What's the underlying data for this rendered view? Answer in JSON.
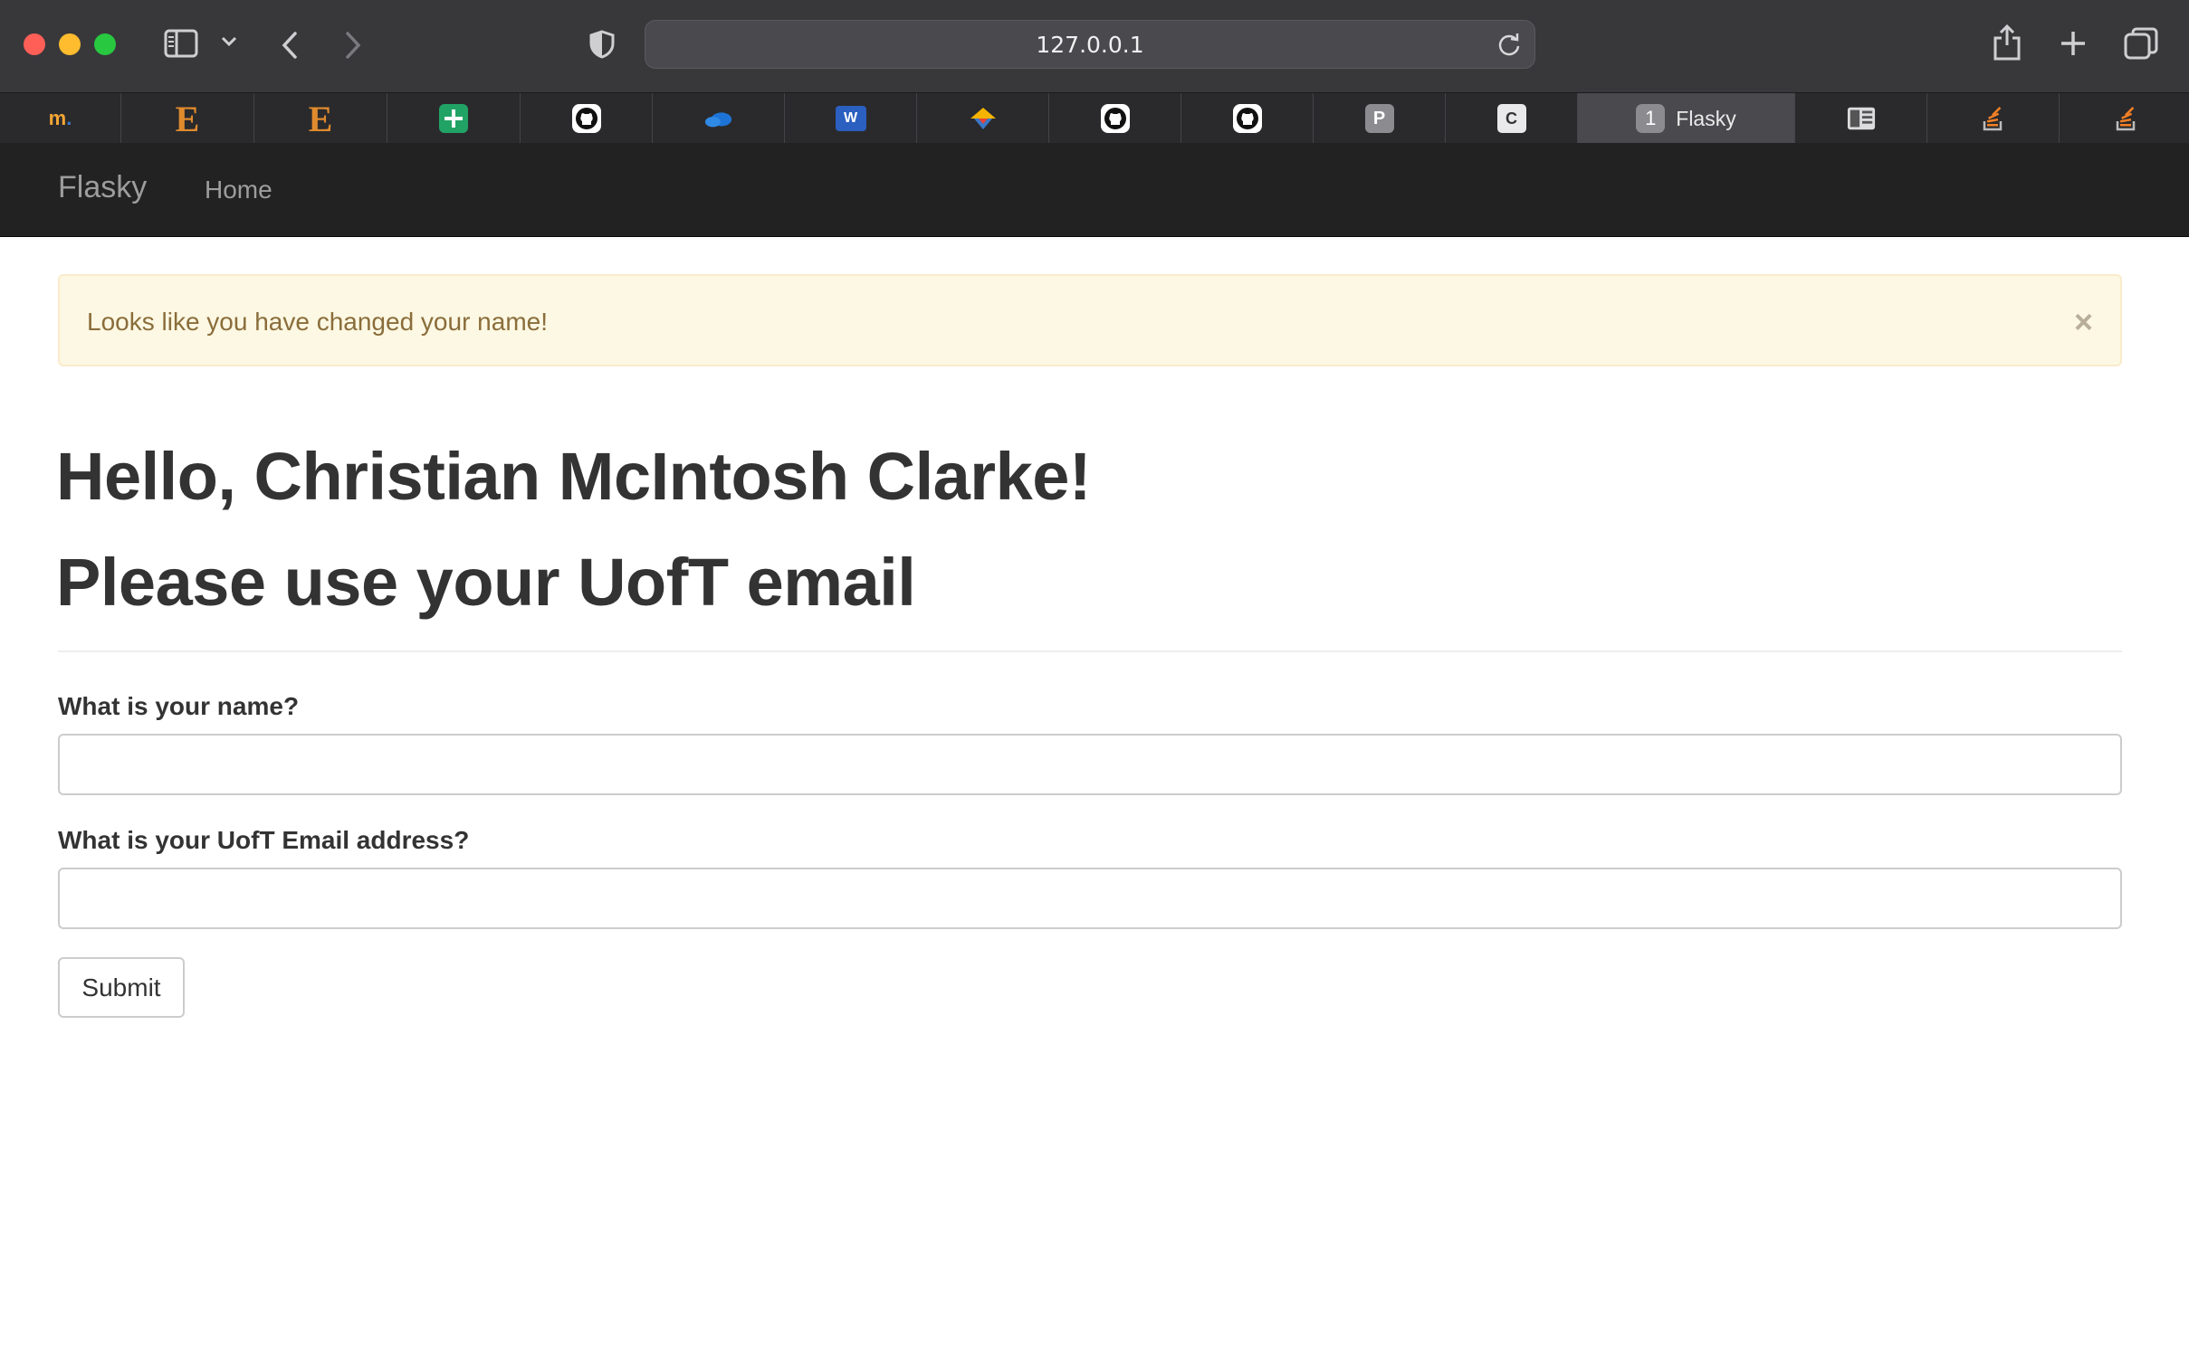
{
  "browser": {
    "url": "127.0.0.1",
    "tabs": [
      {
        "icon": "m-logo-icon",
        "label": ""
      },
      {
        "icon": "etymology-e-icon",
        "label": ""
      },
      {
        "icon": "etymology-e-icon",
        "label": ""
      },
      {
        "icon": "google-sheets-icon",
        "label": ""
      },
      {
        "icon": "github-icon",
        "label": ""
      },
      {
        "icon": "onedrive-icon",
        "label": ""
      },
      {
        "icon": "word-icon",
        "label": ""
      },
      {
        "icon": "colorful-umbrella-icon",
        "label": ""
      },
      {
        "icon": "github-icon",
        "label": ""
      },
      {
        "icon": "github-icon",
        "label": ""
      },
      {
        "icon": "p-letter-icon",
        "label": ""
      },
      {
        "icon": "terminal-c-icon",
        "label": ""
      },
      {
        "icon": "badge-number-icon",
        "badge": "1",
        "label": "Flasky",
        "active": true
      },
      {
        "icon": "reader-icon",
        "label": ""
      },
      {
        "icon": "stackoverflow-icon",
        "label": ""
      },
      {
        "icon": "stackoverflow-icon",
        "label": ""
      }
    ],
    "tab_letters": {
      "e": "E",
      "p": "P",
      "c": "C"
    }
  },
  "navbar": {
    "brand": "Flasky",
    "home": "Home"
  },
  "alert": {
    "message": "Looks like you have changed your name!",
    "close": "×"
  },
  "page": {
    "greeting": "Hello, Christian McIntosh Clarke!",
    "subheading": "Please use your UofT email"
  },
  "form": {
    "name_label": "What is your name?",
    "name_value": "",
    "email_label": "What is your UofT Email address?",
    "email_value": "",
    "submit_label": "Submit"
  },
  "colors": {
    "navbar_bg": "#222222",
    "alert_bg": "#fcf8e3",
    "alert_text": "#8a6d3b",
    "chrome_bg": "#38383b"
  }
}
